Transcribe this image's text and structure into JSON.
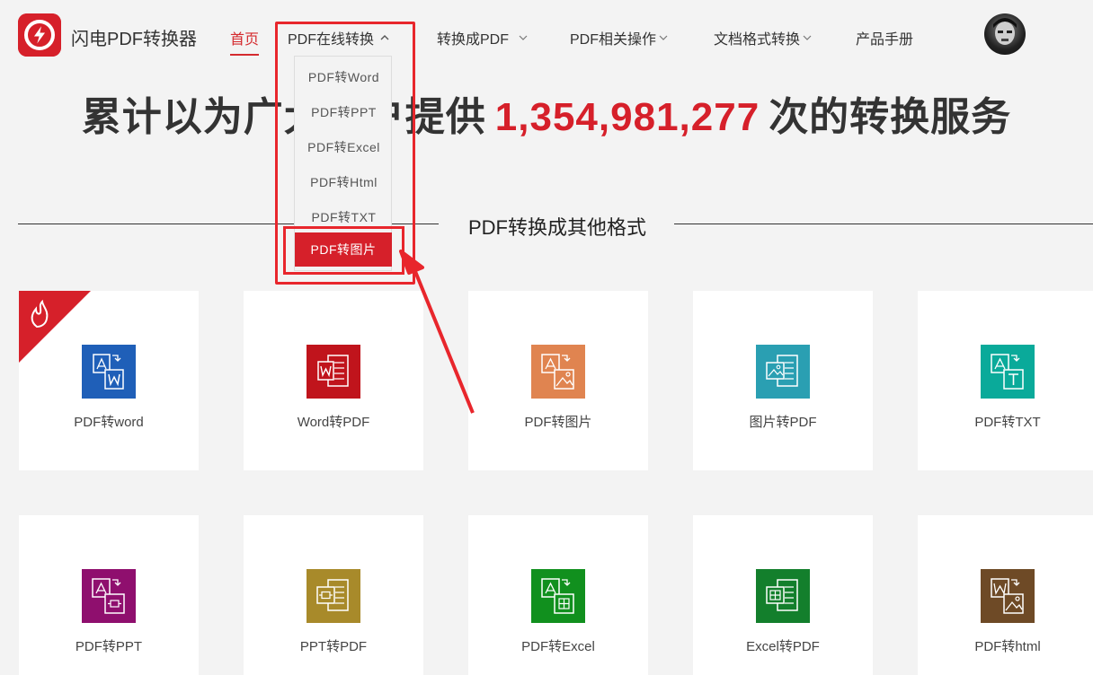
{
  "header": {
    "logo_text": "闪电PDF转换器",
    "nav": [
      {
        "label": "首页",
        "active": true
      },
      {
        "label": "PDF在线转换",
        "chevron": "up"
      },
      {
        "label": "转换成PDF",
        "chevron": "down"
      },
      {
        "label": "PDF相关操作",
        "chevron": "down"
      },
      {
        "label": "文档格式转换",
        "chevron": "down"
      },
      {
        "label": "产品手册"
      }
    ]
  },
  "dropdown": {
    "items": [
      "PDF转Word",
      "PDF转PPT",
      "PDF转Excel",
      "PDF转Html",
      "PDF转TXT",
      "PDF转图片"
    ],
    "selected_index": 5
  },
  "headline": {
    "prefix": "累计以为广大用户提供",
    "count": "1,354,981,277",
    "suffix": "次的转换服务"
  },
  "section": {
    "title": "PDF转换成其他格式"
  },
  "cards": [
    {
      "label": "PDF转word",
      "color": "#1f5fb8",
      "icon": "pdf-to-word-icon",
      "hot": true
    },
    {
      "label": "Word转PDF",
      "color": "#c0141c",
      "icon": "word-to-pdf-icon"
    },
    {
      "label": "PDF转图片",
      "color": "#e08450",
      "icon": "pdf-to-image-icon"
    },
    {
      "label": "图片转PDF",
      "color": "#2a9fb2",
      "icon": "image-to-pdf-icon"
    },
    {
      "label": "PDF转TXT",
      "color": "#0aaa9a",
      "icon": "pdf-to-txt-icon"
    },
    {
      "label": "PDF转PPT",
      "color": "#8f0f6e",
      "icon": "pdf-to-ppt-icon"
    },
    {
      "label": "PPT转PDF",
      "color": "#a88a2a",
      "icon": "ppt-to-pdf-icon"
    },
    {
      "label": "PDF转Excel",
      "color": "#11901e",
      "icon": "pdf-to-excel-icon"
    },
    {
      "label": "Excel转PDF",
      "color": "#137f2c",
      "icon": "excel-to-pdf-icon"
    },
    {
      "label": "PDF转html",
      "color": "#6e4a26",
      "icon": "pdf-to-html-icon"
    }
  ],
  "colors": {
    "accent": "#d6202a",
    "annotation": "#e8262c"
  }
}
